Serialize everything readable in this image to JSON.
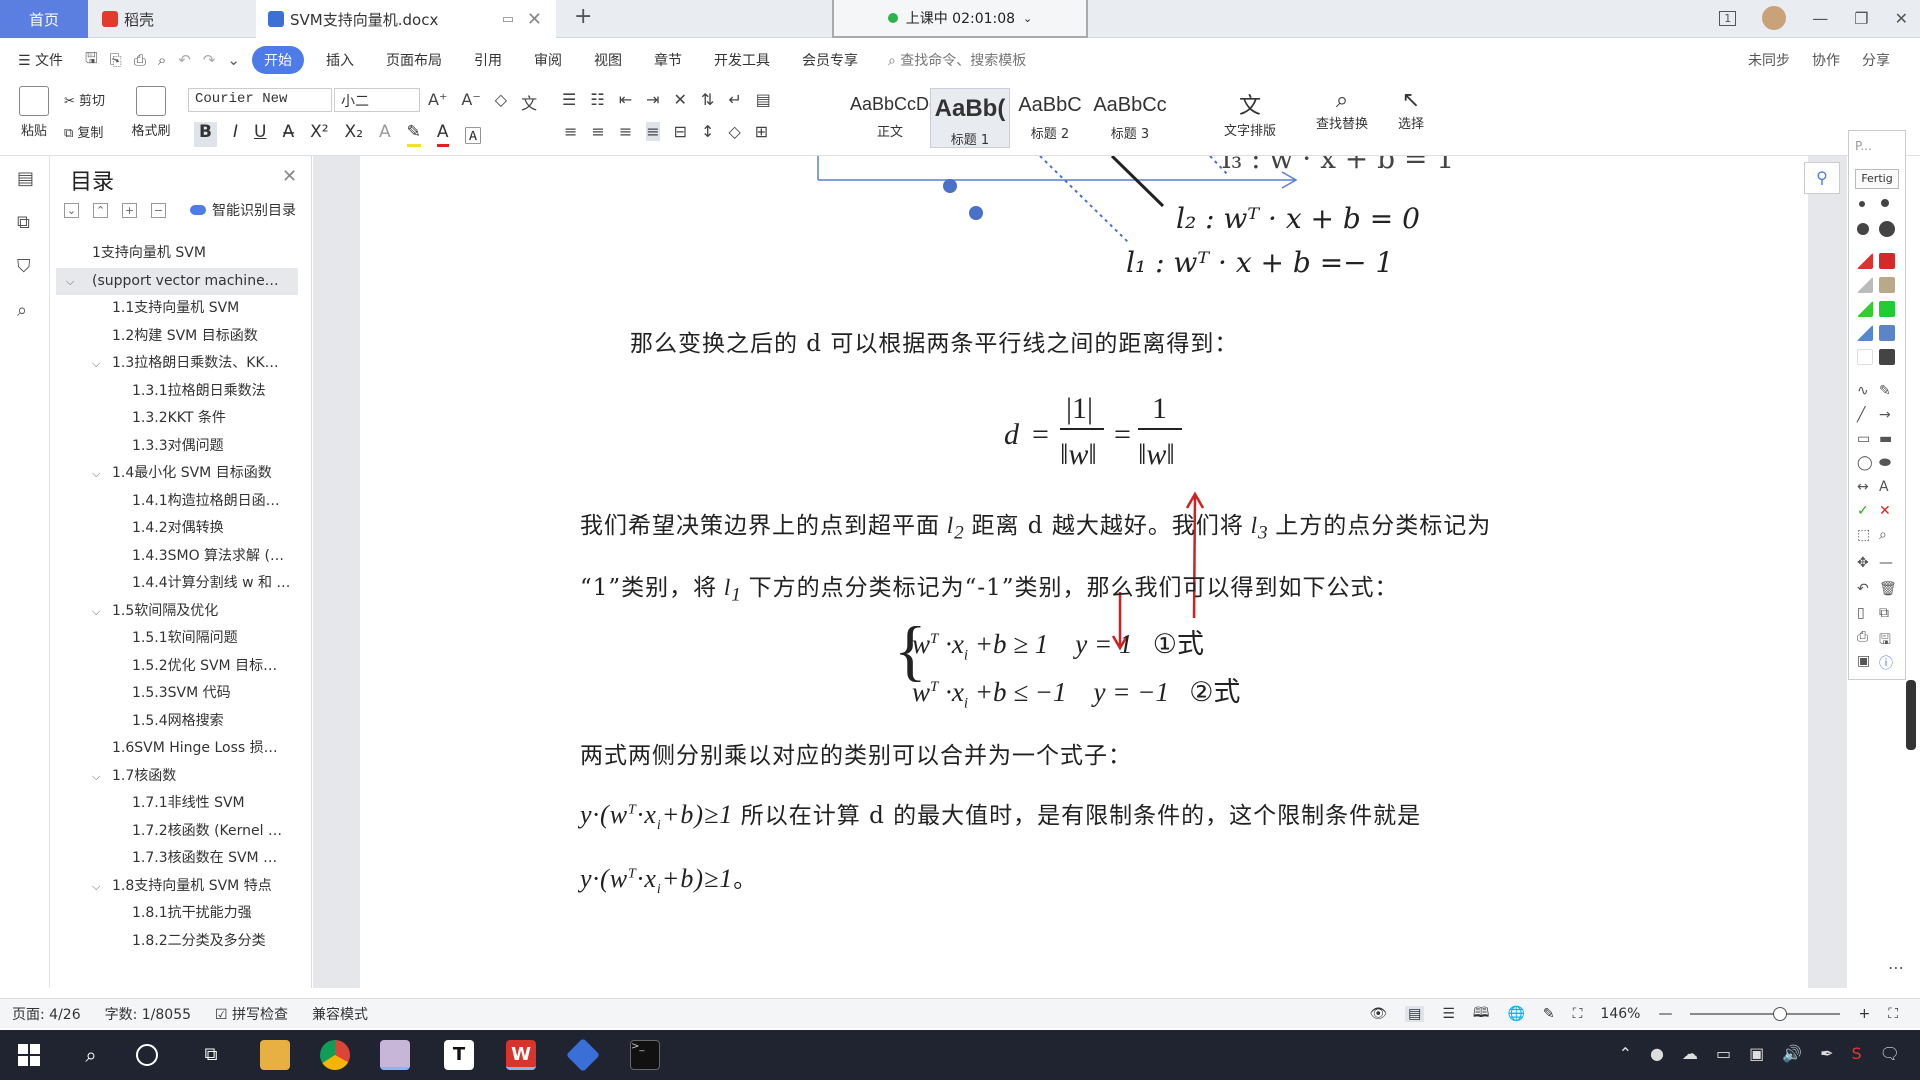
{
  "tabs": {
    "home": "首页",
    "daoke": "稻壳",
    "doc": "SVM支持向量机.docx"
  },
  "class_status": "上课中 02:01:08",
  "menu": {
    "file": "文件",
    "items": [
      "开始",
      "插入",
      "页面布局",
      "引用",
      "审阅",
      "视图",
      "章节",
      "开发工具",
      "会员专享"
    ],
    "search_placeholder": "查找命令、搜索模板",
    "right": [
      "未同步",
      "协作",
      "分享"
    ]
  },
  "ribbon": {
    "paste": "粘贴",
    "cut": "剪切",
    "copy": "复制",
    "format_painter": "格式刷",
    "font": "Courier New",
    "size": "小二",
    "styles": [
      {
        "sample": "AaBbCcDd",
        "name": "正文"
      },
      {
        "sample": "AaBb(",
        "name": "标题 1"
      },
      {
        "sample": "AaBbC",
        "name": "标题 2"
      },
      {
        "sample": "AaBbCc",
        "name": "标题 3"
      }
    ],
    "text_layout": "文字排版",
    "find_replace": "查找替换",
    "select": "选择"
  },
  "toc": {
    "title": "目录",
    "smart": "智能识别目录",
    "items": [
      {
        "label": "1支持向量机 SVM",
        "level": 0
      },
      {
        "label": "(support vector machine…",
        "level": 0,
        "arrow": "down",
        "selected": true
      },
      {
        "label": "1.1支持向量机 SVM",
        "level": 1
      },
      {
        "label": "1.2构建 SVM 目标函数",
        "level": 1
      },
      {
        "label": "1.3拉格朗日乘数法、KK…",
        "level": 1,
        "arrow": "down"
      },
      {
        "label": "1.3.1拉格朗日乘数法",
        "level": 2
      },
      {
        "label": "1.3.2KKT 条件",
        "level": 2
      },
      {
        "label": "1.3.3对偶问题",
        "level": 2
      },
      {
        "label": "1.4最小化 SVM 目标函数",
        "level": 1,
        "arrow": "down"
      },
      {
        "label": "1.4.1构造拉格朗日函…",
        "level": 2
      },
      {
        "label": "1.4.2对偶转换",
        "level": 2
      },
      {
        "label": "1.4.3SMO 算法求解 (…",
        "level": 2
      },
      {
        "label": "1.4.4计算分割线 w 和 …",
        "level": 2
      },
      {
        "label": "1.5软间隔及优化",
        "level": 1,
        "arrow": "down"
      },
      {
        "label": "1.5.1软间隔问题",
        "level": 2
      },
      {
        "label": "1.5.2优化 SVM 目标…",
        "level": 2
      },
      {
        "label": "1.5.3SVM 代码",
        "level": 2
      },
      {
        "label": "1.5.4网格搜索",
        "level": 2
      },
      {
        "label": "1.6SVM Hinge Loss 损…",
        "level": 1
      },
      {
        "label": "1.7核函数",
        "level": 1,
        "arrow": "down"
      },
      {
        "label": "1.7.1非线性 SVM",
        "level": 2
      },
      {
        "label": "1.7.2核函数 (Kernel …",
        "level": 2
      },
      {
        "label": "1.7.3核函数在 SVM …",
        "level": 2
      },
      {
        "label": "1.8支持向量机 SVM 特点",
        "level": 1,
        "arrow": "down"
      },
      {
        "label": "1.8.1抗干扰能力强",
        "level": 2
      },
      {
        "label": "1.8.2二分类及多分类",
        "level": 2
      }
    ]
  },
  "document": {
    "l2_eq": "l₂ : wᵀ · x + b = 0",
    "l1_eq": "l₁ : wᵀ · x + b =− 1",
    "para1": "那么变换之后的 d 可以根据两条平行线之间的距离得到：",
    "para2a": "我们希望决策边界上的点到超平面",
    "para2b": "距离 d 越大越好。我们将",
    "para2c": "上方的点分类标记为",
    "para3a": "“1”类别，将",
    "para3b": "下方的点分类标记为“-1”类别，那么我们可以得到如下公式：",
    "eq1_tag": "①式",
    "eq2_tag": "②式",
    "para4": "两式两侧分别乘以对应的类别可以合并为一个式子：",
    "para5": "所以在计算 d 的最大值时，是有限制条件的，这个限制条件就是",
    "para6_end": "。"
  },
  "drawing_panel": {
    "fertig": "Fertig"
  },
  "status": {
    "page": "页面: 4/26",
    "words": "字数: 1/8055",
    "spell": "拼写检查",
    "compat": "兼容模式",
    "zoom": "146%",
    "zoom_level": 0.6
  },
  "colors": {
    "accent": "#4d7be8",
    "home_tab": "#5b7fe0",
    "red_arrow": "#cc2222",
    "axis_blue": "#5a7fd0",
    "dot_blue": "#4a70c8"
  }
}
